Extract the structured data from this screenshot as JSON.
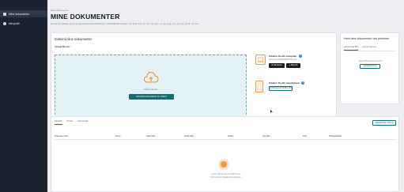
{
  "sidebar": {
    "items": [
      {
        "icon": "documents-icon",
        "label": "Mine dokumenter",
        "active": true
      },
      {
        "icon": "user-icon",
        "label": "Min profil",
        "active": false
      }
    ]
  },
  "breadcrumb": "Mine dokumenter",
  "page": {
    "title": "MINE DOKUMENTER",
    "description": "Her kan du uploade, printe og administrere dine dokumenter. Understøttede formater: pdf, docx, doc, xls, xlsx, ppt, pptx, txt, jpg, jpeg, png, gif, bmp, tif, tiff, odt, ods."
  },
  "upload": {
    "title": "Indsend dine dokumenter",
    "field_label": "Upload filer her",
    "drop_text": "Træk & slip filer",
    "button": "UPLOAD DOKUMENT TIL PRINT"
  },
  "download_computer": {
    "title": "Udskriv fra din computer",
    "subtitle": "Download SMARTPRINT klienten",
    "windows_button": "Windows",
    "mac_button": "MacOS"
  },
  "download_phone": {
    "title": "Udskriv fra din smartphone",
    "button": "DOWNLOAD MOBIL APP"
  },
  "print_card": {
    "title": "Hent dine dokumenter ved printeren",
    "tabs": [
      "Log ind med PIN",
      "Log ind med kort"
    ],
    "note": "Ingen PIN genereret endnu",
    "button": "GENERER PIN"
  },
  "docs": {
    "tabs": [
      "Aktuelle",
      "Printet",
      "Downloads"
    ],
    "refresh_button": "GENNEMSE STATUS",
    "columns": [
      "Dokumentnavn",
      "Farve",
      "Sider/side",
      "Antal sider",
      "Status",
      "Oprettet",
      "Filer",
      "Tilbagebetalte"
    ],
    "empty_title": "Ingen dokumenter til udskrivning",
    "empty_sub": "Start med at uploade dit dokument"
  },
  "colors": {
    "sidebar": "#1b2330",
    "accent": "#0f6d76",
    "orange": "#f29a3b",
    "dropzone": "#e3f2f7"
  }
}
